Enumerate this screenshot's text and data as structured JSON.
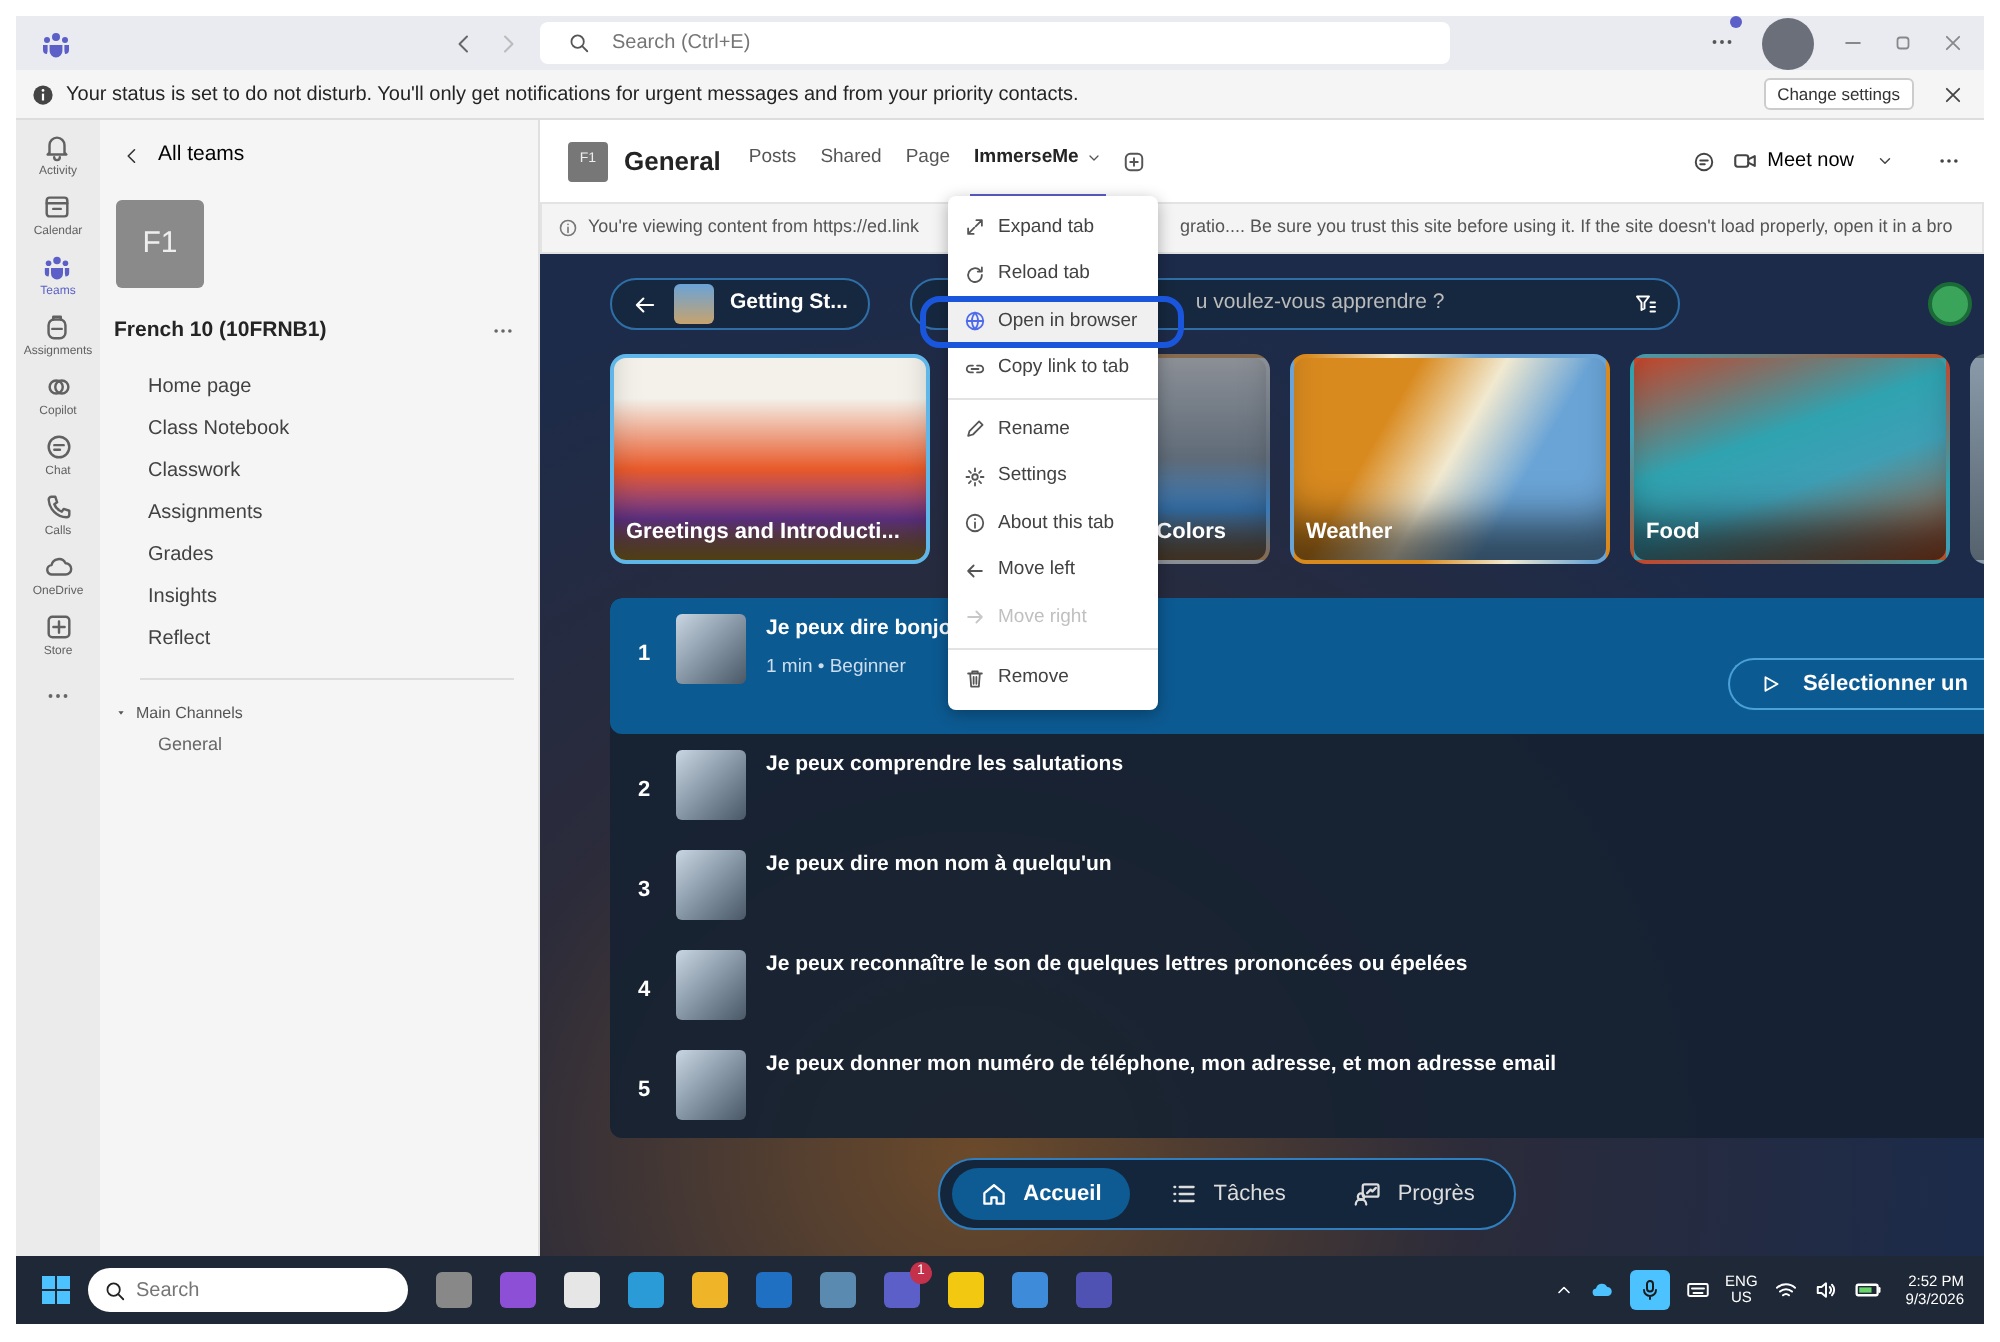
{
  "title_bar": {
    "search_placeholder": "Search (Ctrl+E)"
  },
  "notice": {
    "text": "Your status is set to do not disturb. You'll only get notifications for urgent messages and from your priority contacts.",
    "button": "Change settings"
  },
  "app_rail": [
    {
      "label": "Activity",
      "selected": false
    },
    {
      "label": "Calendar",
      "selected": false
    },
    {
      "label": "Teams",
      "selected": true
    },
    {
      "label": "Assignments",
      "selected": false
    },
    {
      "label": "Copilot",
      "selected": false
    },
    {
      "label": "Chat",
      "selected": false
    },
    {
      "label": "Calls",
      "selected": false
    },
    {
      "label": "OneDrive",
      "selected": false
    },
    {
      "label": "Store",
      "selected": false
    }
  ],
  "team_panel": {
    "back": "All teams",
    "avatar": "F1",
    "name": "French 10 (10FRNB1)",
    "items": [
      "Home page",
      "Class Notebook",
      "Classwork",
      "Assignments",
      "Grades",
      "Insights",
      "Reflect"
    ],
    "section": "Main Channels",
    "section_expanded": true,
    "channels": [
      "General"
    ]
  },
  "channel_header": {
    "avatar": "F1",
    "title": "General",
    "tabs": [
      {
        "label": "Posts",
        "selected": false
      },
      {
        "label": "Shared",
        "selected": false
      },
      {
        "label": "Page",
        "selected": false
      },
      {
        "label": "ImmerseMe",
        "selected": true
      }
    ],
    "meet": "Meet now"
  },
  "info_bar": {
    "text_before": "You're viewing content from https://ed.link",
    "text_after": "gratio.... Be sure you trust this site before using it. If the site doesn't load properly, open it in a bro"
  },
  "tab_menu": {
    "groups": [
      [
        {
          "label": "Expand tab",
          "disabled": false,
          "highlighted": false
        },
        {
          "label": "Reload tab",
          "disabled": false,
          "highlighted": false
        },
        {
          "label": "Open in browser",
          "disabled": false,
          "highlighted": true
        },
        {
          "label": "Copy link to tab",
          "disabled": false,
          "highlighted": false
        }
      ],
      [
        {
          "label": "Rename",
          "disabled": false,
          "highlighted": false
        },
        {
          "label": "Settings",
          "disabled": false,
          "highlighted": false
        },
        {
          "label": "About this tab",
          "disabled": false,
          "highlighted": false
        },
        {
          "label": "Move left",
          "disabled": false,
          "highlighted": false
        },
        {
          "label": "Move right",
          "disabled": true,
          "highlighted": false
        }
      ],
      [
        {
          "label": "Remove",
          "disabled": false,
          "highlighted": false
        }
      ]
    ]
  },
  "immerse": {
    "back_label": "Getting St...",
    "search_placeholder": "u voulez-vous apprendre ?",
    "categories": [
      {
        "label": "Greetings and Introducti...",
        "selected": true,
        "partly_hidden": false
      },
      {
        "label": "Colors",
        "selected": false,
        "partly_hidden": true
      },
      {
        "label": "Weather",
        "selected": false,
        "partly_hidden": false
      },
      {
        "label": "Food",
        "selected": false,
        "partly_hidden": false
      }
    ],
    "lessons": [
      {
        "number": "1",
        "title": "Je peux dire bonjo",
        "meta": "1 min • Beginner",
        "action": "Sélectionner un",
        "selected": true
      },
      {
        "number": "2",
        "title": "Je peux comprendre les salutations",
        "selected": false
      },
      {
        "number": "3",
        "title": "Je peux dire mon nom à quelqu'un",
        "selected": false
      },
      {
        "number": "4",
        "title": "Je peux reconnaître le son de quelques lettres prononcées ou épelées",
        "selected": false
      },
      {
        "number": "5",
        "title": "Je peux donner mon numéro de téléphone, mon adresse, et mon adresse email",
        "selected": false
      }
    ],
    "nav": [
      {
        "label": "Accueil",
        "selected": true
      },
      {
        "label": "Tâches",
        "selected": false
      },
      {
        "label": "Progrès",
        "selected": false
      }
    ]
  },
  "taskbar": {
    "search_placeholder": "Search",
    "badge": "1",
    "language": "ENG",
    "region": "US",
    "time": "2:52 PM",
    "date": "9/3/2026"
  }
}
